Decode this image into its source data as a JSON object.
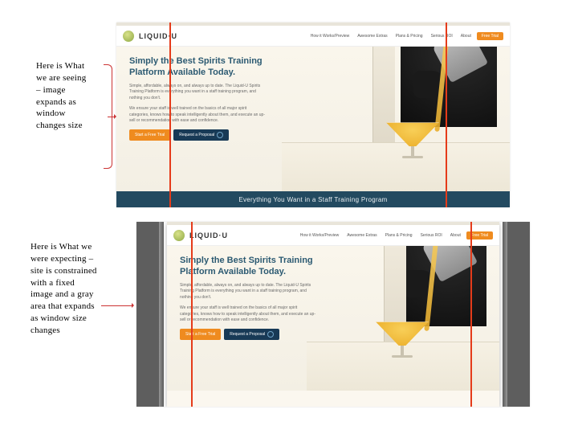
{
  "captions": {
    "seeing": "Here is What we are seeing – image expands as window changes size",
    "expecting": "Here is What we were expecting – site is constrained with a fixed image and a gray area that expands as window size changes"
  },
  "site": {
    "brand": "LIQUID·U",
    "nav": {
      "item1": "How it Works/Preview",
      "item2": "Awesome Extras",
      "item3": "Plans & Pricing",
      "item4": "Serious ROI",
      "item5": "About",
      "trial": "Free Trial"
    },
    "hero": {
      "headline": "Simply the Best Spirits Training Platform Available Today.",
      "p1": "Simple, affordable, always on, and always up to date. The Liquid-U Spirits Training Platform is everything you want in a staff training program, and nothing you don't.",
      "p2": "We ensure your staff is well trained on the basics of all major spirit categories, knows how to speak intelligently about them, and execute an up-sell or recommendation with ease and confidence.",
      "cta1": "Start a Free Trial",
      "cta2": "Request a Proposal"
    },
    "band": "Everything You Want in a Staff Training Program"
  }
}
